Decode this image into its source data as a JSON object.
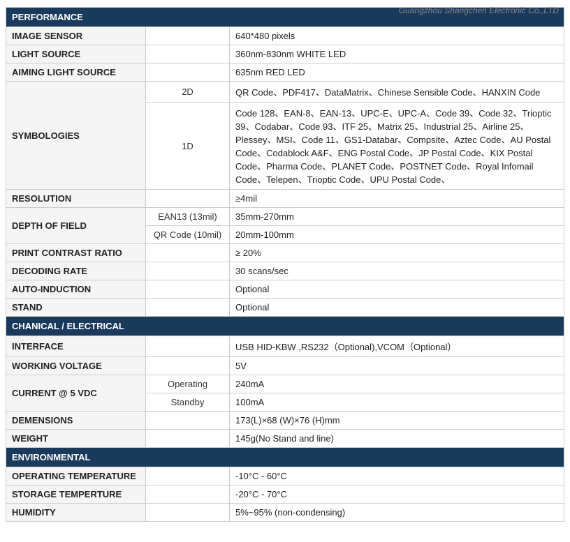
{
  "watermark": "Guangzhou Shangchen Electronic Co.,LTD",
  "sections": [
    {
      "type": "header",
      "label": "PERFORMANCE"
    },
    {
      "type": "simple",
      "label": "IMAGE SENSOR",
      "value": "640*480 pixels"
    },
    {
      "type": "simple",
      "label": "LIGHT SOURCE",
      "value": "360nm-830nm WHITE LED"
    },
    {
      "type": "simple",
      "label": "AIMING LIGHT SOURCE",
      "value": "635nm RED LED"
    },
    {
      "type": "sub",
      "label": "SYMBOLOGIES",
      "rows": [
        {
          "sub": "2D",
          "value": "QR Code、PDF417、DataMatrix、Chinese Sensible Code、HANXIN Code"
        },
        {
          "sub": "1D",
          "value": "Code 128、EAN-8、EAN-13、UPC-E、UPC-A、Code 39、Code 32、Trioptic 39、Codabar、Code 93、ITF 25、Matrix 25、Industrial 25、Airline 25、Plessey、MSI、Code 11、GS1-Databar、Compsite、Aztec Code、AU Postal Code、Codablock A&F、ENG Postal Code、JP Postal Code、KIX Postal Code、Pharma Code、PLANET Code、POSTNET Code、Royal Infomail Code、Telepen、Trioptic Code、UPU Postal Code、"
        }
      ]
    },
    {
      "type": "simple",
      "label": "RESOLUTION",
      "value": "≥4mil"
    },
    {
      "type": "sub",
      "label": "DEPTH OF FIELD",
      "rows": [
        {
          "sub": "EAN13 (13mil)",
          "value": "35mm-270mm"
        },
        {
          "sub": "QR Code (10mil)",
          "value": "20mm-100mm"
        }
      ]
    },
    {
      "type": "simple",
      "label": "PRINT CONTRAST RATIO",
      "value": "≥ 20%"
    },
    {
      "type": "simple",
      "label": "DECODING RATE",
      "value": "30 scans/sec"
    },
    {
      "type": "simple",
      "label": "AUTO-INDUCTION",
      "value": "Optional"
    },
    {
      "type": "simple",
      "label": "STAND",
      "value": "Optional"
    },
    {
      "type": "header",
      "label": "CHANICAL / ELECTRICAL"
    },
    {
      "type": "simple",
      "label": "INTERFACE",
      "value": "USB HID-KBW ,RS232（Optional),VCOM（Optional）"
    },
    {
      "type": "simple",
      "label": "WORKING VOLTAGE",
      "value": "5V"
    },
    {
      "type": "sub",
      "label": "CURRENT @ 5 VDC",
      "rows": [
        {
          "sub": "Operating",
          "value": "240mA"
        },
        {
          "sub": "Standby",
          "value": "100mA"
        }
      ]
    },
    {
      "type": "simple",
      "label": "DEMENSIONS",
      "value": "173(L)×68 (W)×76 (H)mm"
    },
    {
      "type": "simple",
      "label": "WEIGHT",
      "value": "145g(No Stand and line)"
    },
    {
      "type": "header",
      "label": "ENVIRONMENTAL"
    },
    {
      "type": "simple",
      "label": "OPERATING TEMPERATURE",
      "value": "-10°C - 60°C"
    },
    {
      "type": "simple",
      "label": "STORAGE TEMPERTURE",
      "value": "-20°C - 70°C"
    },
    {
      "type": "simple",
      "label": "HUMIDITY",
      "value": "5%~95% (non-condensing)"
    }
  ]
}
